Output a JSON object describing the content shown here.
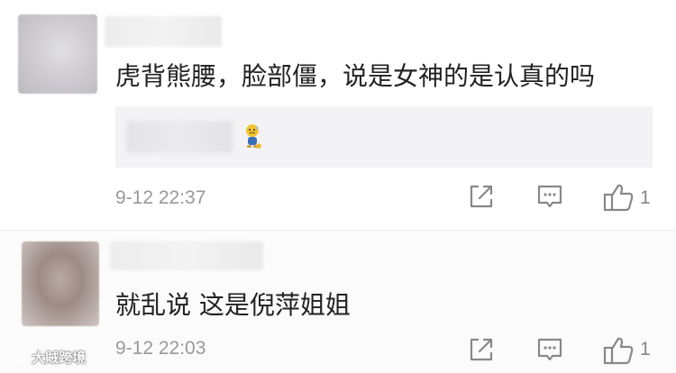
{
  "comments": [
    {
      "text": "虎背熊腰，脸部僵，说是女神的是认真的吗",
      "time": "9-12 22:37",
      "likes": "1",
      "has_reply_preview": true,
      "reply_emoji_icon": "sweat-doll-emoji-icon"
    },
    {
      "text": "就乱说 这是倪萍姐姐",
      "time": "9-12 22:03",
      "likes": "1"
    }
  ],
  "icons": {
    "share": "share-icon",
    "reply": "comment-icon",
    "like": "thumbs-up-icon"
  },
  "watermark": {
    "text": "大賊跨境"
  },
  "colors": {
    "text": "#222222",
    "muted": "#999999",
    "icon": "#888888",
    "reply_bg": "#f3f3f5"
  }
}
